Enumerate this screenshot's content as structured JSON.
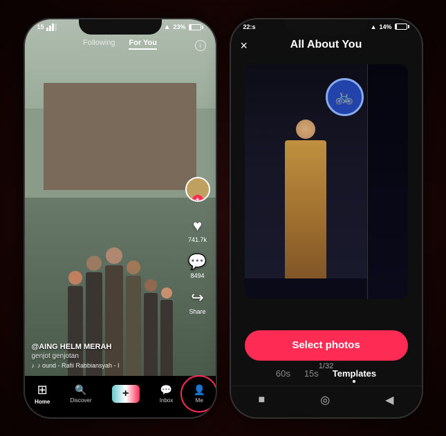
{
  "phone1": {
    "status": {
      "signal": "15",
      "wifi": "wifi",
      "battery_pct": "23%"
    },
    "nav": {
      "following": "Following",
      "for_you": "For You"
    },
    "side_actions": {
      "likes": "741.7k",
      "comments": "8494",
      "share": "Share"
    },
    "video_info": {
      "username": "@AING HELM MERAH",
      "caption": "genjot genjotan",
      "sound": "♪ ound - Rafii Rabbiansyah - I"
    },
    "bottom_nav": [
      {
        "label": "Home",
        "icon": "⊞"
      },
      {
        "label": "Discover",
        "icon": "🔍"
      },
      {
        "label": "+",
        "icon": "+"
      },
      {
        "label": "Inbox",
        "icon": "💬"
      },
      {
        "label": "Me",
        "icon": "👤"
      }
    ]
  },
  "phone2": {
    "status": {
      "time": "22:s",
      "battery_pct": "14%"
    },
    "screen_title": "All About You",
    "close_icon": "×",
    "photo_counter": "1/32",
    "select_button": "Select photos",
    "time_tabs": [
      {
        "label": "60s",
        "active": false
      },
      {
        "label": "15s",
        "active": false
      },
      {
        "label": "Templates",
        "active": true
      }
    ],
    "bottom_icons": [
      "■",
      "◎",
      "◀"
    ]
  }
}
